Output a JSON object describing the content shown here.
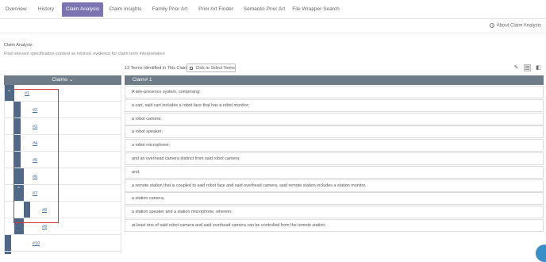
{
  "tabs": [
    {
      "label": "Overview",
      "active": false
    },
    {
      "label": "History",
      "active": false
    },
    {
      "label": "Claim Analysis",
      "active": true
    },
    {
      "label": "Claim Insights",
      "active": false
    },
    {
      "label": "Family Prior Art",
      "active": false
    },
    {
      "label": "Prior Art Finder",
      "active": false
    },
    {
      "label": "Semantic Prior Art",
      "active": false
    },
    {
      "label": "File Wrapper Search",
      "active": false
    }
  ],
  "about_label": "About Claim Analysis",
  "header": {
    "title": "Claim Analysis",
    "subtitle": "Find relevant specification content as intrinsic evidence for claim term interpretation"
  },
  "toolbar": {
    "terms_count_text": "13 Terms Identified in This Claim",
    "select_terms_button": "Click to Select Terms",
    "icons": [
      "pencil-icon",
      "list-view-icon",
      "split-view-icon"
    ]
  },
  "claims": {
    "header": "Claims",
    "items": [
      "#1",
      "#2",
      "#3",
      "#4",
      "#5",
      "#6",
      "#7",
      "#8",
      "#9",
      "#10"
    ]
  },
  "claim_text": {
    "header": "Claim# 1",
    "lines": [
      "A tele-presence system, comprising:",
      "a cart, said cart includes a robot face that has a robot monitor;",
      "a robot camera;",
      "a robot speaker;",
      "a robot microphone;",
      "and an overhead camera distinct from said robot camera;",
      "and,",
      "a remote station that is coupled to said robot face and said overhead camera, said remote station includes a station monitor,",
      "a station camera,",
      "a station speaker and a station microphone, wherein:",
      "at least one of said robot camera and said overhead camera can be controlled from the remote station."
    ]
  },
  "colors": {
    "accent_tab": "#7b74b0",
    "panel_header": "#6e7b89",
    "tree_bar": "#506987",
    "highlight_box": "#d23a3a",
    "link": "#3a6ea5"
  }
}
